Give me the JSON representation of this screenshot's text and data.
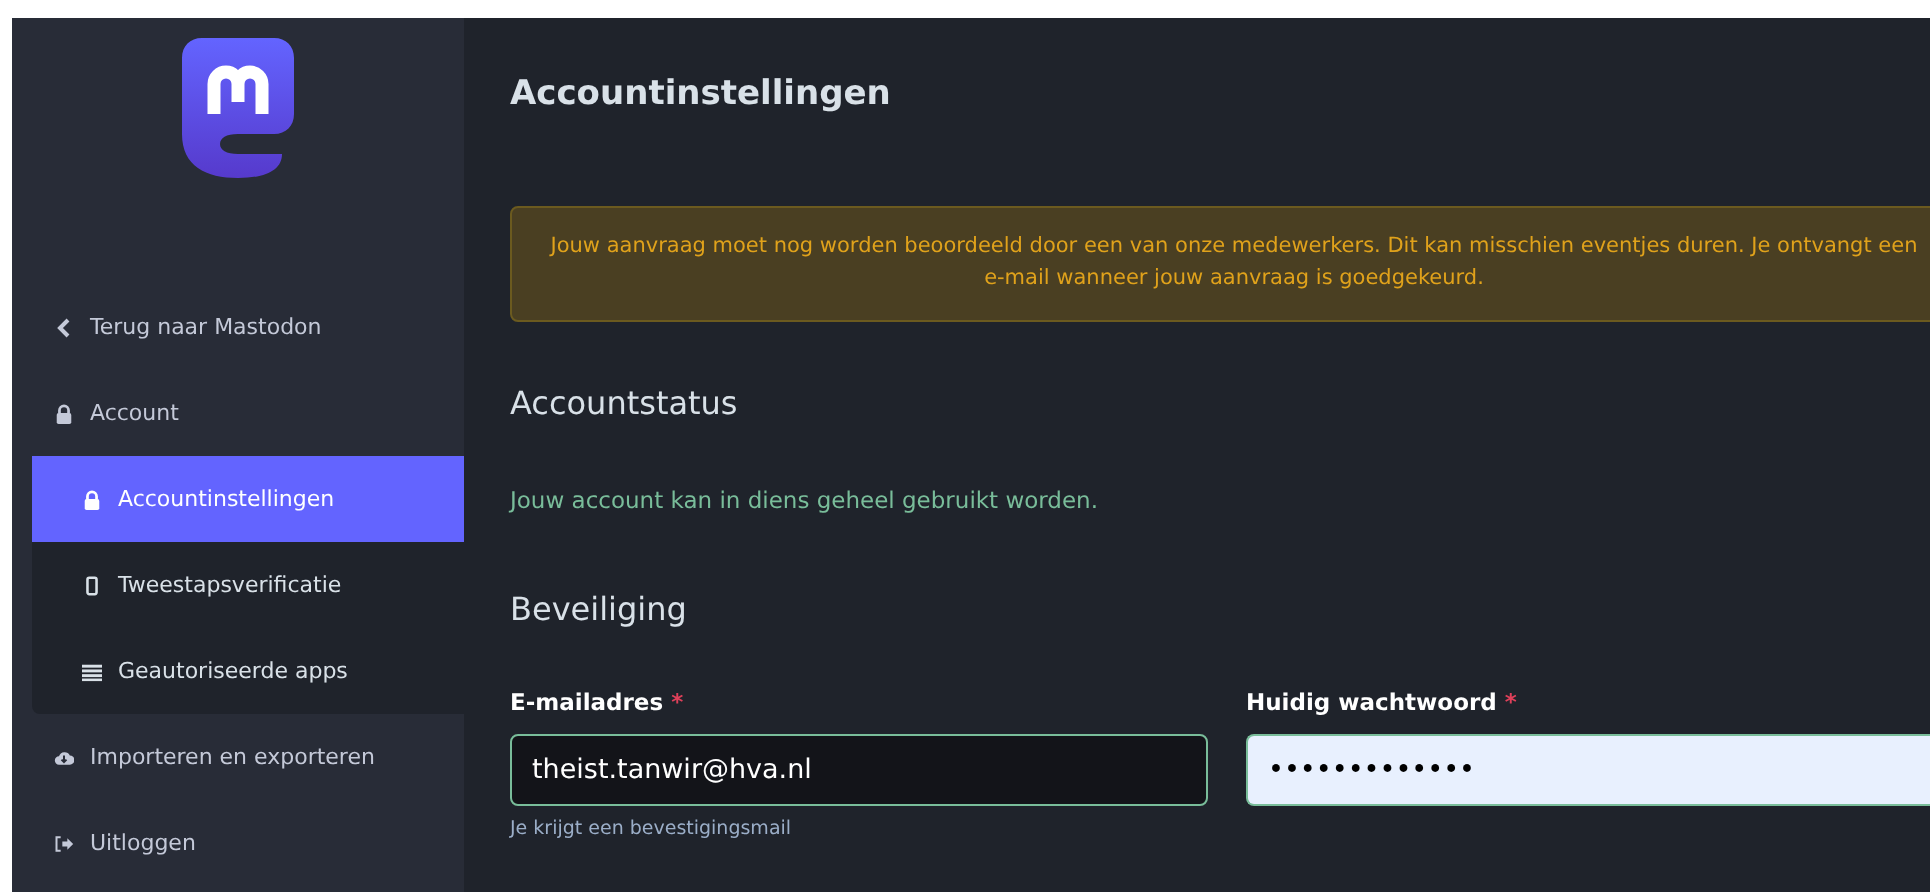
{
  "sidebar": {
    "back_link": "Terug naar Mastodon",
    "items": [
      {
        "label": "Account",
        "kind": "lock",
        "selected": false,
        "children": [
          {
            "label": "Accountinstellingen",
            "kind": "lock",
            "selected": true
          },
          {
            "label": "Tweestapsverificatie",
            "kind": "phone",
            "selected": false
          },
          {
            "label": "Geautoriseerde apps",
            "kind": "list",
            "selected": false
          }
        ]
      },
      {
        "label": "Importeren en exporteren",
        "kind": "cloud",
        "selected": false
      },
      {
        "label": "Uitloggen",
        "kind": "logout",
        "selected": false
      }
    ]
  },
  "page_title": "Accountinstellingen",
  "notice": "Jouw aanvraag moet nog worden beoordeeld door een van onze medewerkers. Dit kan misschien eventjes duren. Je ontvangt een e-mail wanneer jouw aanvraag is goedgekeurd.",
  "account_status": {
    "heading": "Accountstatus",
    "message": "Jouw account kan in diens geheel gebruikt worden."
  },
  "security": {
    "heading": "Beveiliging",
    "fields": [
      {
        "label": "E-mailadres",
        "required": "*",
        "value": "theist.tanwir@hva.nl",
        "hint": "Je krijgt een bevestigingsmail",
        "kind": "dark"
      },
      {
        "label": "Huidig wachtwoord",
        "required": "*",
        "value": "•••••••••••••",
        "kind": "light"
      }
    ]
  }
}
